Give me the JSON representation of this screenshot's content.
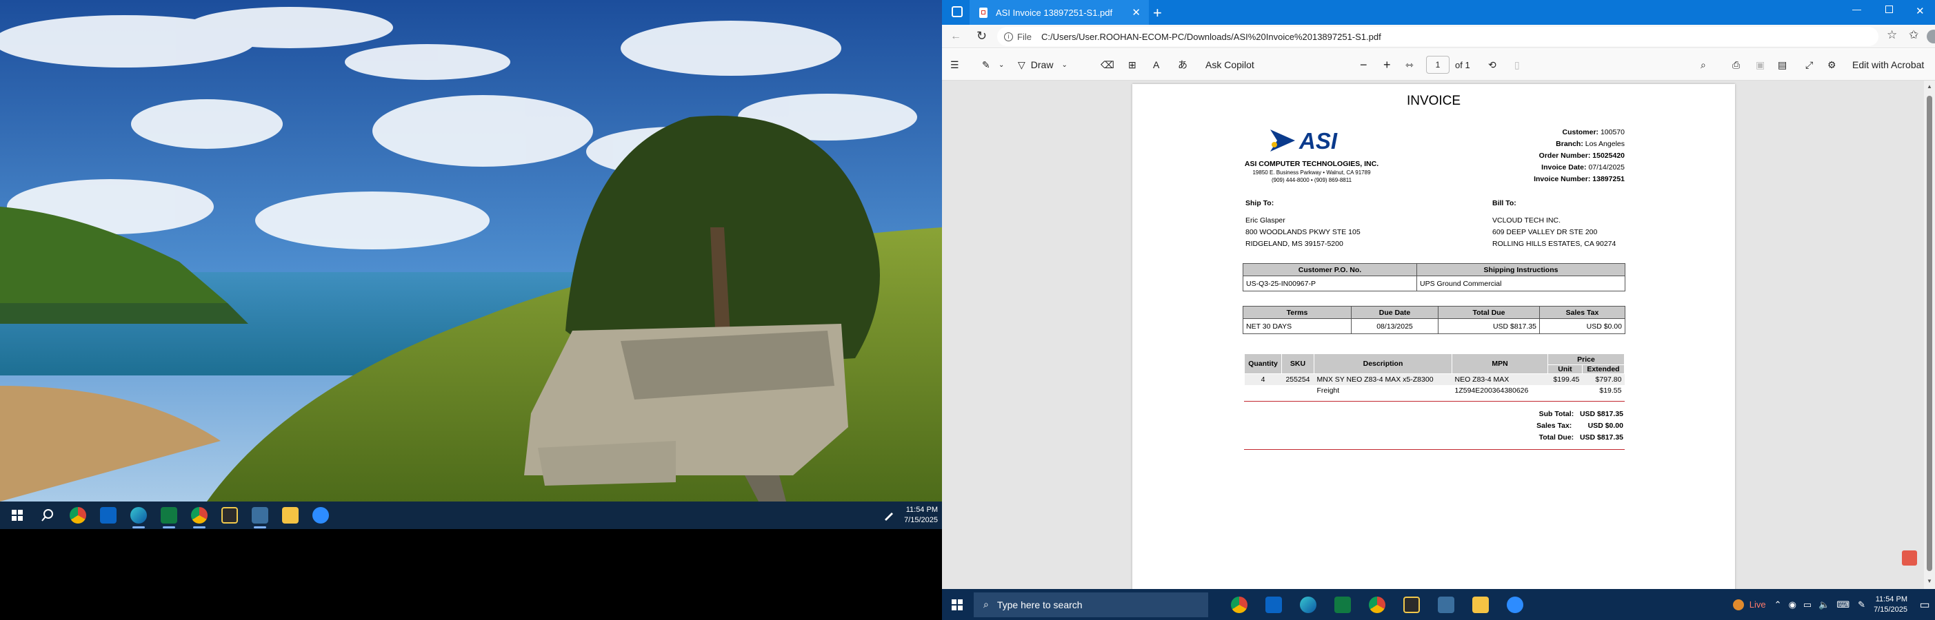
{
  "left_taskbar": {
    "time": "11:54 PM",
    "date": "7/15/2025",
    "apps": [
      "start-icon",
      "search-icon",
      "chrome-icon",
      "outlook-icon",
      "edge-icon",
      "excel-icon",
      "chrome-profile-icon",
      "sticky-notes-icon",
      "calculator-icon",
      "file-explorer-icon",
      "zoom-icon"
    ]
  },
  "browser": {
    "tab_title": "ASI Invoice 13897251-S1.pdf",
    "address_prefix": "File",
    "url": "C:/Users/User.ROOHAN-ECOM-PC/Downloads/ASI%20Invoice%2013897251-S1.pdf"
  },
  "pdf_toolbar": {
    "draw_label": "Draw",
    "copilot_label": "Ask Copilot",
    "page_number": "1",
    "page_total": "of 1",
    "acrobat_label": "Edit with Acrobat"
  },
  "invoice": {
    "title": "INVOICE",
    "logo_text": "ASI",
    "company": "ASI COMPUTER TECHNOLOGIES, INC.",
    "address": "19850 E. Business Parkway • Walnut, CA 91789",
    "phone": "(909) 444-8000 • (909) 869-8811",
    "customer_label": "Customer:",
    "customer": "100570",
    "branch_label": "Branch:",
    "branch": "Los Angeles",
    "order_label": "Order Number:",
    "order": "15025420",
    "inv_date_label": "Invoice Date:",
    "inv_date": "07/14/2025",
    "inv_num_label": "Invoice Number:",
    "inv_num": "13897251",
    "ship_to_label": "Ship To:",
    "ship_to": [
      "Eric Glasper",
      "800 WOODLANDS PKWY STE 105",
      "RIDGELAND, MS 39157-5200"
    ],
    "bill_to_label": "Bill To:",
    "bill_to": [
      "VCLOUD TECH INC.",
      "609 DEEP VALLEY DR STE 200",
      "ROLLING HILLS ESTATES, CA 90274"
    ],
    "po_header": "Customer P.O. No.",
    "po": "US-Q3-25-IN00967-P",
    "ship_instr_header": "Shipping Instructions",
    "ship_instr": "UPS Ground Commercial",
    "terms_header": "Terms",
    "terms": "NET 30 DAYS",
    "due_header": "Due Date",
    "due": "08/13/2025",
    "total_header": "Total Due",
    "total": "USD $817.35",
    "tax_header": "Sales Tax",
    "tax": "USD $0.00",
    "items_headers": {
      "qty": "Quantity",
      "sku": "SKU",
      "desc": "Description",
      "mpn": "MPN",
      "price": "Price",
      "unit": "Unit",
      "ext": "Extended"
    },
    "items": [
      {
        "qty": "4",
        "sku": "255254",
        "desc": "MNX SY NEO Z83-4 MAX x5-Z8300",
        "mpn": "NEO Z83-4 MAX",
        "unit": "$199.45",
        "ext": "$797.80"
      },
      {
        "qty": "",
        "sku": "",
        "desc": "Freight",
        "mpn": "1Z594E200364380626",
        "unit": "",
        "ext": "$19.55"
      }
    ],
    "subtotal_label": "Sub Total:",
    "subtotal": "USD $817.35",
    "salestax_label": "Sales Tax:",
    "salestax": "USD $0.00",
    "totaldue_label": "Total Due:",
    "totaldue": "USD $817.35"
  },
  "right_taskbar": {
    "search_placeholder": "Type here to search",
    "live_label": "Live",
    "time": "11:54 PM",
    "date": "7/15/2025"
  }
}
